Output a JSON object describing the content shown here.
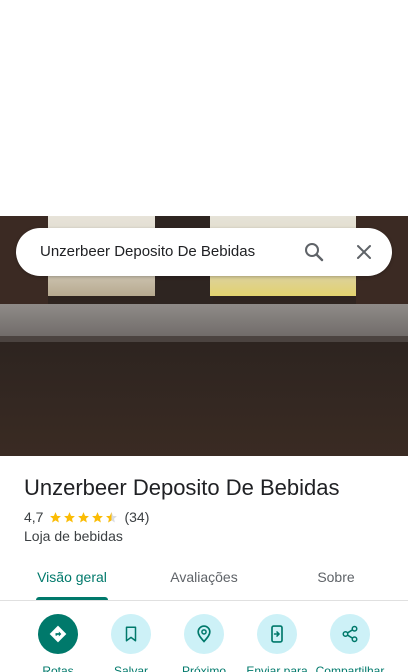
{
  "search": {
    "value": "Unzerbeer Deposito De Bebidas"
  },
  "place": {
    "title": "Unzerbeer Deposito De Bebidas",
    "rating": "4,7",
    "stars": 4.7,
    "reviews": "(34)",
    "category": "Loja de bebidas"
  },
  "tabs": [
    {
      "label": "Visão geral",
      "active": true
    },
    {
      "label": "Avaliações",
      "active": false
    },
    {
      "label": "Sobre",
      "active": false
    }
  ],
  "actions": [
    {
      "label": "Rotas",
      "icon": "directions-icon"
    },
    {
      "label": "Salvar",
      "icon": "bookmark-icon"
    },
    {
      "label": "Próximo",
      "icon": "nearby-icon"
    },
    {
      "label": "Enviar para",
      "icon": "send-to-phone-icon"
    },
    {
      "label": "Compartilhar",
      "icon": "share-icon"
    }
  ],
  "colors": {
    "accent": "#00796b",
    "star": "#fbbc04",
    "action_bg": "#cdf1f7"
  }
}
